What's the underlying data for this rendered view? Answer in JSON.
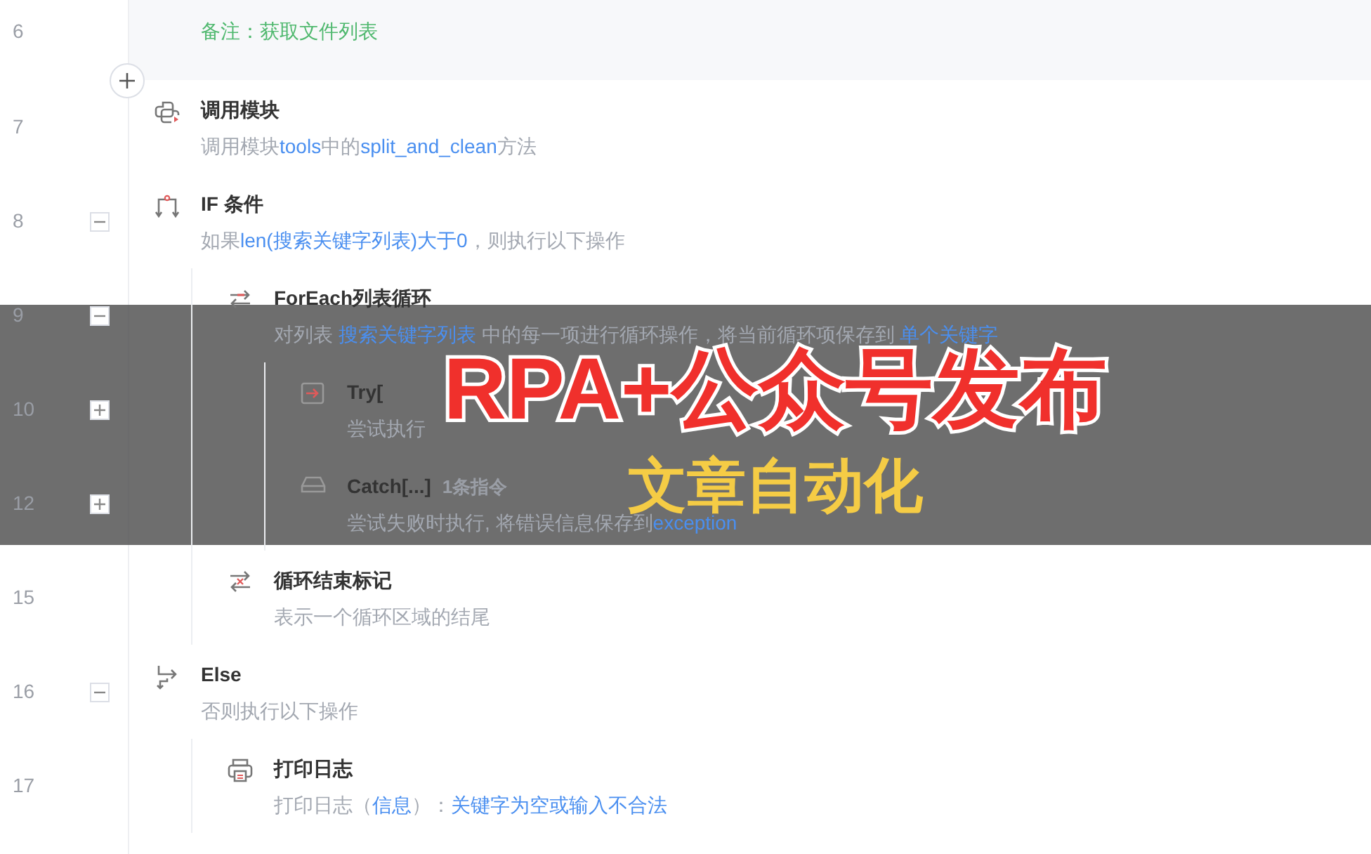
{
  "steps": [
    {
      "line": "6",
      "kind": "note",
      "text": "备注：获取文件列表"
    },
    {
      "line": "7",
      "kind": "module",
      "title": "调用模块",
      "desc": [
        {
          "text": "调用模块",
          "kind": "plain"
        },
        {
          "text": "tools",
          "kind": "var"
        },
        {
          "text": "中的",
          "kind": "plain"
        },
        {
          "text": "split_and_clean",
          "kind": "var"
        },
        {
          "text": "方法",
          "kind": "plain"
        }
      ]
    },
    {
      "line": "8",
      "kind": "if",
      "expanded": true,
      "title": "IF 条件",
      "desc": [
        {
          "text": "如果",
          "kind": "plain"
        },
        {
          "text": "len(搜索关键字列表)大于0",
          "kind": "var"
        },
        {
          "text": "，则执行以下操作",
          "kind": "plain"
        }
      ],
      "children": [
        {
          "line": "9",
          "kind": "foreach",
          "expanded": true,
          "title": "ForEach列表循环",
          "desc": [
            {
              "text": "对列表",
              "kind": "plain"
            },
            {
              "text": "搜索关键字列表",
              "kind": "var"
            },
            {
              "text": "中的每一项进行循环操作，将当前循环项保存到",
              "kind": "plain"
            },
            {
              "text": "单个关键字",
              "kind": "var"
            }
          ],
          "children": [
            {
              "line": "10",
              "kind": "try",
              "expanded": false,
              "title": "Try[",
              "desc": [
                {
                  "text": "尝试执行",
                  "kind": "plain"
                }
              ]
            },
            {
              "line": "12",
              "kind": "catch",
              "expanded": false,
              "title": "Catch[...]",
              "count": "1条指令",
              "desc": [
                {
                  "text": "尝试失败时执行, 将错误信息保存到",
                  "kind": "plain"
                },
                {
                  "text": "exception",
                  "kind": "var"
                }
              ]
            }
          ]
        },
        {
          "line": "15",
          "kind": "loopend",
          "title": "循环结束标记",
          "desc": [
            {
              "text": "表示一个循环区域的结尾",
              "kind": "plain"
            }
          ]
        }
      ]
    },
    {
      "line": "16",
      "kind": "else",
      "expanded": true,
      "title": "Else",
      "desc": [
        {
          "text": "否则执行以下操作",
          "kind": "plain"
        }
      ],
      "children": [
        {
          "line": "17",
          "kind": "log",
          "title": "打印日志",
          "desc": [
            {
              "text": "打印日志（",
              "kind": "plain"
            },
            {
              "text": "信息",
              "kind": "var"
            },
            {
              "text": "）：",
              "kind": "plain"
            },
            {
              "text": "关键字为空或输入不合法",
              "kind": "var"
            }
          ]
        }
      ]
    }
  ],
  "banner": {
    "title": "RPA+公众号发布",
    "subtitle": "文章自动化"
  }
}
